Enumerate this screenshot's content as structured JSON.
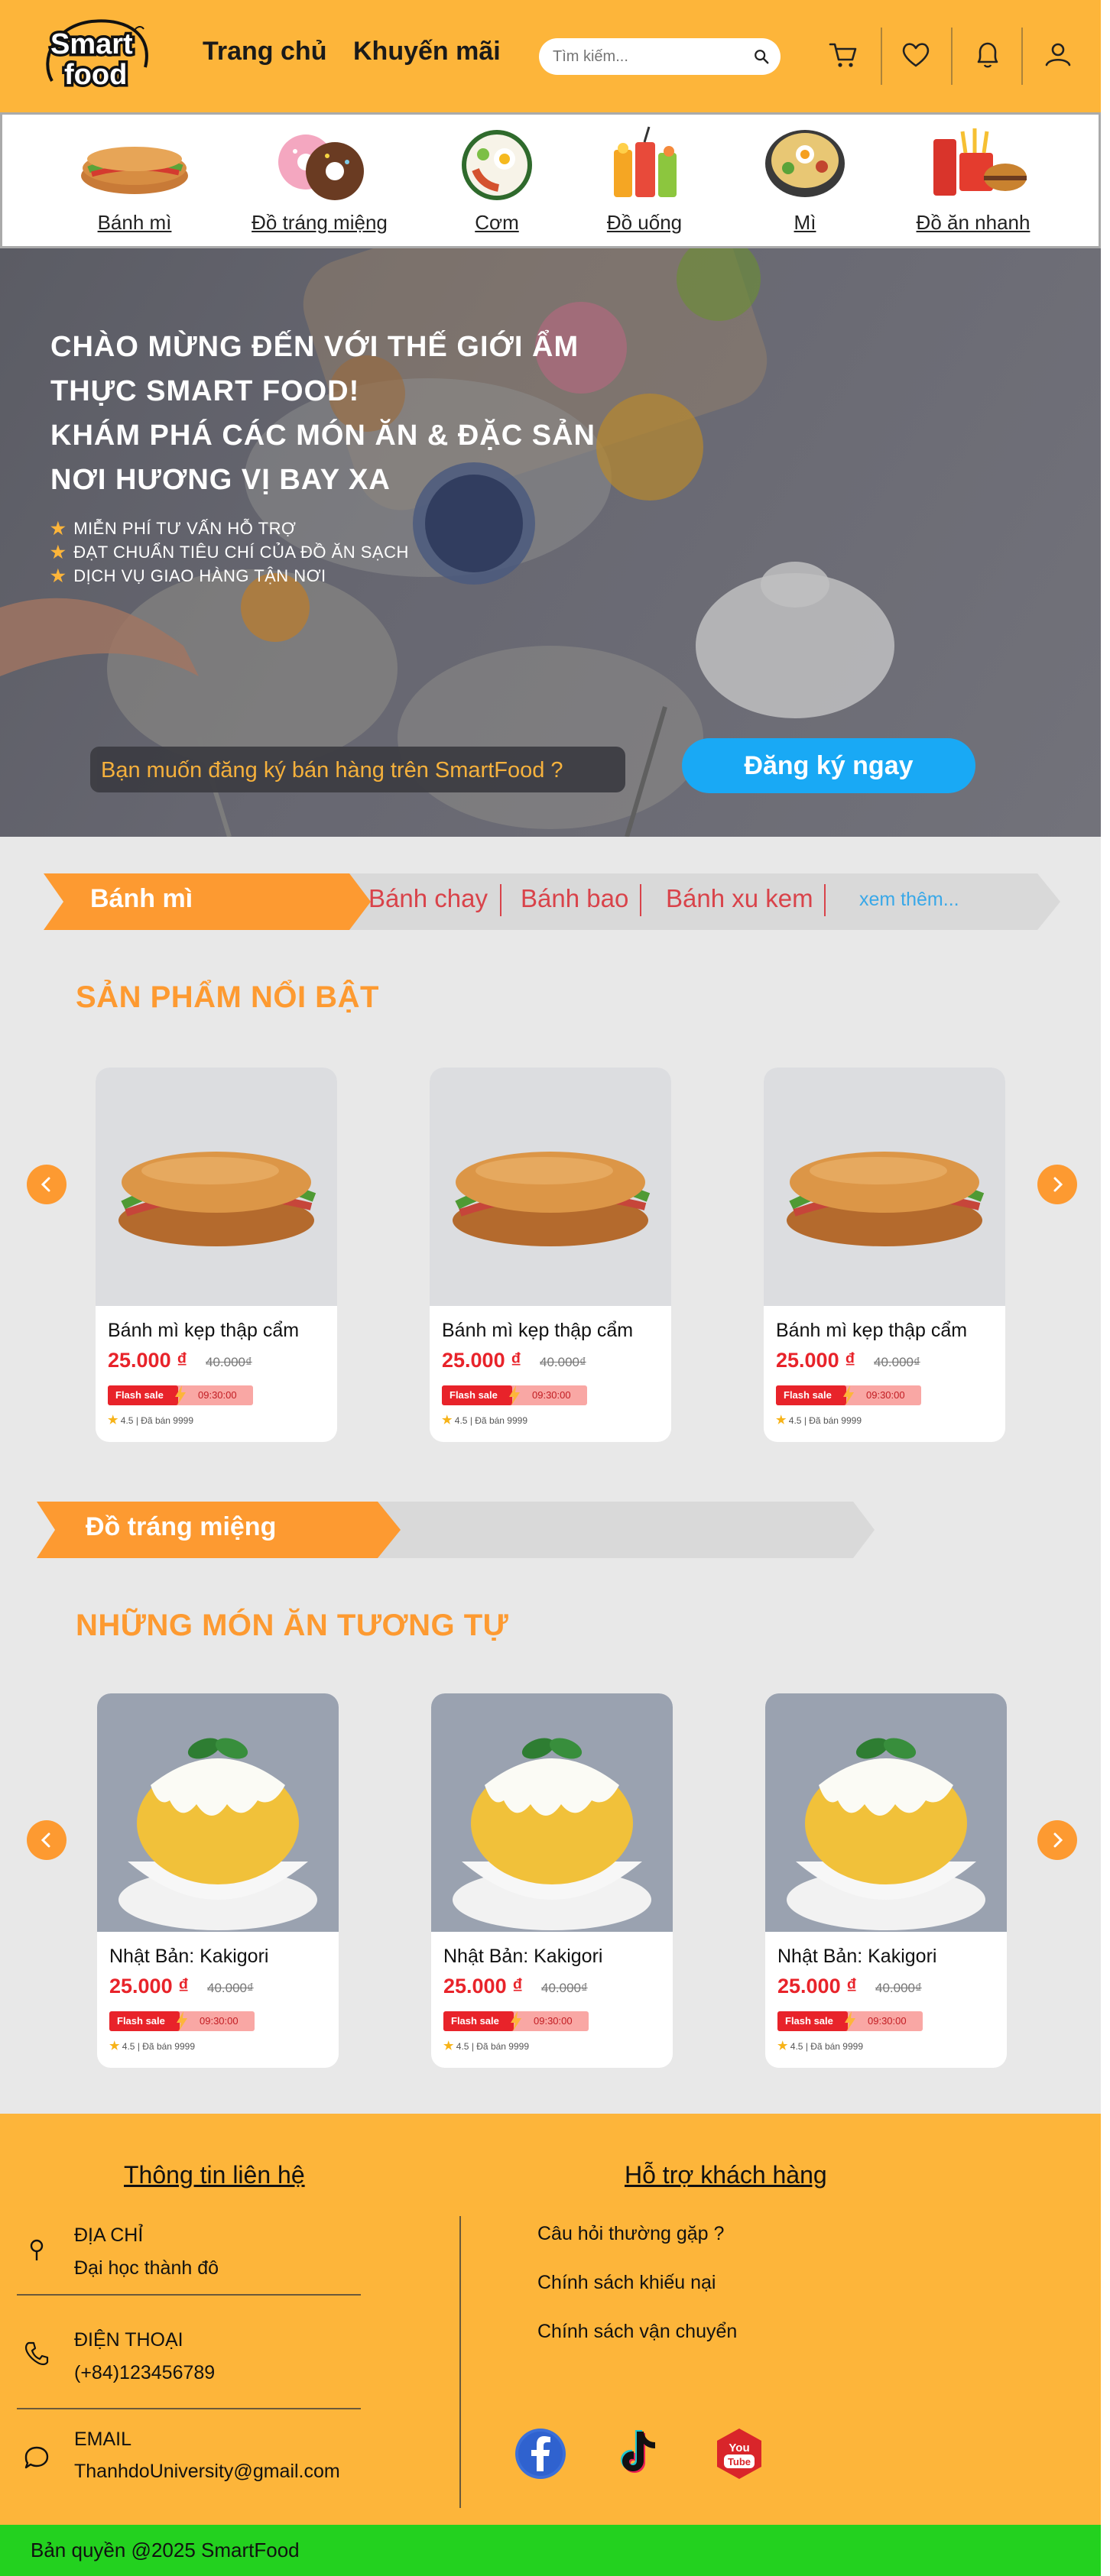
{
  "header": {
    "logo_line1": "Smart",
    "logo_line2": "food",
    "nav": [
      "Trang chủ",
      "Khuyến mãi"
    ],
    "search_placeholder": "Tìm kiếm...",
    "icons": [
      "cart-icon",
      "heart-icon",
      "bell-icon",
      "user-icon"
    ],
    "color": "#fdb53a"
  },
  "categories": [
    {
      "label": "Bánh mì",
      "icon": "banh-mi-image"
    },
    {
      "label": "Đồ tráng miệng",
      "icon": "donut-image"
    },
    {
      "label": "Cơm",
      "icon": "rice-plate-image"
    },
    {
      "label": "Đồ uống",
      "icon": "drinks-image"
    },
    {
      "label": "Mì",
      "icon": "noodle-bowl-image"
    },
    {
      "label": "Đồ ăn nhanh",
      "icon": "fast-food-image"
    }
  ],
  "hero": {
    "title_lines": [
      "CHÀO MỪNG ĐẾN VỚI THẾ GIỚI ẨM",
      "THỰC SMART FOOD!",
      "KHÁM PHÁ CÁC MÓN ĂN & ĐẶC SẢN",
      "NƠI HƯƠNG VỊ BAY XA"
    ],
    "features": [
      "MIỄN PHÍ TƯ VẤN HỖ TRỢ",
      "ĐẠT CHUẨN TIÊU CHÍ CỦA ĐỒ ĂN SẠCH",
      "DỊCH VỤ GIAO HÀNG TẬN NƠI"
    ],
    "seller_prompt": "Bạn muốn đăng ký bán hàng trên SmartFood ?",
    "signup_button": "Đăng ký ngay"
  },
  "section1": {
    "active_tab": "Bánh mì",
    "tabs": [
      "Bánh chay",
      "Bánh bao",
      "Bánh xu kem"
    ],
    "more": "xem thêm...",
    "heading": "SẢN PHẨM NỔI BẬT",
    "products": [
      {
        "name": "Bánh mì kẹp thập cẩm",
        "price": "25.000 ₫",
        "old_price": "40.000₫",
        "flash": "Flash sale",
        "time": "09:30:00",
        "rating": "4.5 | Đã bán 9999"
      },
      {
        "name": "Bánh mì kẹp thập cẩm",
        "price": "25.000 ₫",
        "old_price": "40.000₫",
        "flash": "Flash sale",
        "time": "09:30:00",
        "rating": "4.5 | Đã bán 9999"
      },
      {
        "name": "Bánh mì kẹp thập cẩm",
        "price": "25.000 ₫",
        "old_price": "40.000₫",
        "flash": "Flash sale",
        "time": "09:30:00",
        "rating": "4.5 | Đã bán 9999"
      }
    ]
  },
  "section2": {
    "active_tab": "Đồ tráng miệng",
    "heading": "NHỮNG MÓN ĂN TƯƠNG TỰ",
    "products": [
      {
        "name": "Nhật Bản: Kakigori",
        "price": "25.000 ₫",
        "old_price": "40.000₫",
        "flash": "Flash sale",
        "time": "09:30:00",
        "rating": "4.5 | Đã bán 9999"
      },
      {
        "name": "Nhật Bản: Kakigori",
        "price": "25.000 ₫",
        "old_price": "40.000₫",
        "flash": "Flash sale",
        "time": "09:30:00",
        "rating": "4.5 | Đã bán 9999"
      },
      {
        "name": "Nhật Bản: Kakigori",
        "price": "25.000 ₫",
        "old_price": "40.000₫",
        "flash": "Flash sale",
        "time": "09:30:00",
        "rating": "4.5 | Đã bán 9999"
      }
    ]
  },
  "footer": {
    "contact_heading": "Thông tin liên hệ",
    "support_heading": "Hỗ trợ khách hàng",
    "address_label": "ĐỊA CHỈ",
    "address_value": "Đại học thành đô",
    "phone_label": "ĐIỆN THOẠI",
    "phone_value": "(+84)123456789",
    "email_label": "EMAIL",
    "email_value": "ThanhdoUniversity@gmail.com",
    "support_links": [
      "Câu hỏi thường gặp ?",
      "Chính sách khiếu nại",
      "Chính sách vận chuyển"
    ],
    "socials": [
      "facebook-icon",
      "tiktok-icon",
      "youtube-icon"
    ],
    "youtube_text_1": "You",
    "youtube_text_2": "Tube",
    "copyright": "Bản quyền  @2025 SmartFood"
  },
  "colors": {
    "accent": "#fd9a31",
    "footer_bg": "#fdb53a",
    "copyright_bg": "#23d11f",
    "signup": "#19a9f5",
    "price": "#e8232a"
  }
}
